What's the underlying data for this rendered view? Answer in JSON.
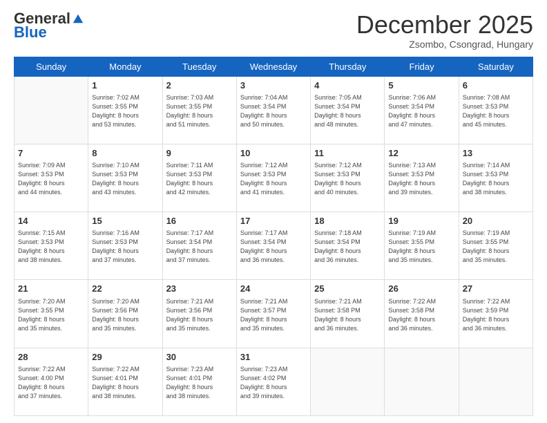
{
  "logo": {
    "general": "General",
    "blue": "Blue"
  },
  "header": {
    "month": "December 2025",
    "location": "Zsombo, Csongrad, Hungary"
  },
  "weekdays": [
    "Sunday",
    "Monday",
    "Tuesday",
    "Wednesday",
    "Thursday",
    "Friday",
    "Saturday"
  ],
  "weeks": [
    [
      {
        "day": null
      },
      {
        "day": 1,
        "sunrise": "7:02 AM",
        "sunset": "3:55 PM",
        "daylight": "8 hours and 53 minutes."
      },
      {
        "day": 2,
        "sunrise": "7:03 AM",
        "sunset": "3:55 PM",
        "daylight": "8 hours and 51 minutes."
      },
      {
        "day": 3,
        "sunrise": "7:04 AM",
        "sunset": "3:54 PM",
        "daylight": "8 hours and 50 minutes."
      },
      {
        "day": 4,
        "sunrise": "7:05 AM",
        "sunset": "3:54 PM",
        "daylight": "8 hours and 48 minutes."
      },
      {
        "day": 5,
        "sunrise": "7:06 AM",
        "sunset": "3:54 PM",
        "daylight": "8 hours and 47 minutes."
      },
      {
        "day": 6,
        "sunrise": "7:08 AM",
        "sunset": "3:53 PM",
        "daylight": "8 hours and 45 minutes."
      }
    ],
    [
      {
        "day": 7,
        "sunrise": "7:09 AM",
        "sunset": "3:53 PM",
        "daylight": "8 hours and 44 minutes."
      },
      {
        "day": 8,
        "sunrise": "7:10 AM",
        "sunset": "3:53 PM",
        "daylight": "8 hours and 43 minutes."
      },
      {
        "day": 9,
        "sunrise": "7:11 AM",
        "sunset": "3:53 PM",
        "daylight": "8 hours and 42 minutes."
      },
      {
        "day": 10,
        "sunrise": "7:12 AM",
        "sunset": "3:53 PM",
        "daylight": "8 hours and 41 minutes."
      },
      {
        "day": 11,
        "sunrise": "7:12 AM",
        "sunset": "3:53 PM",
        "daylight": "8 hours and 40 minutes."
      },
      {
        "day": 12,
        "sunrise": "7:13 AM",
        "sunset": "3:53 PM",
        "daylight": "8 hours and 39 minutes."
      },
      {
        "day": 13,
        "sunrise": "7:14 AM",
        "sunset": "3:53 PM",
        "daylight": "8 hours and 38 minutes."
      }
    ],
    [
      {
        "day": 14,
        "sunrise": "7:15 AM",
        "sunset": "3:53 PM",
        "daylight": "8 hours and 38 minutes."
      },
      {
        "day": 15,
        "sunrise": "7:16 AM",
        "sunset": "3:53 PM",
        "daylight": "8 hours and 37 minutes."
      },
      {
        "day": 16,
        "sunrise": "7:17 AM",
        "sunset": "3:54 PM",
        "daylight": "8 hours and 37 minutes."
      },
      {
        "day": 17,
        "sunrise": "7:17 AM",
        "sunset": "3:54 PM",
        "daylight": "8 hours and 36 minutes."
      },
      {
        "day": 18,
        "sunrise": "7:18 AM",
        "sunset": "3:54 PM",
        "daylight": "8 hours and 36 minutes."
      },
      {
        "day": 19,
        "sunrise": "7:19 AM",
        "sunset": "3:55 PM",
        "daylight": "8 hours and 35 minutes."
      },
      {
        "day": 20,
        "sunrise": "7:19 AM",
        "sunset": "3:55 PM",
        "daylight": "8 hours and 35 minutes."
      }
    ],
    [
      {
        "day": 21,
        "sunrise": "7:20 AM",
        "sunset": "3:55 PM",
        "daylight": "8 hours and 35 minutes."
      },
      {
        "day": 22,
        "sunrise": "7:20 AM",
        "sunset": "3:56 PM",
        "daylight": "8 hours and 35 minutes."
      },
      {
        "day": 23,
        "sunrise": "7:21 AM",
        "sunset": "3:56 PM",
        "daylight": "8 hours and 35 minutes."
      },
      {
        "day": 24,
        "sunrise": "7:21 AM",
        "sunset": "3:57 PM",
        "daylight": "8 hours and 35 minutes."
      },
      {
        "day": 25,
        "sunrise": "7:21 AM",
        "sunset": "3:58 PM",
        "daylight": "8 hours and 36 minutes."
      },
      {
        "day": 26,
        "sunrise": "7:22 AM",
        "sunset": "3:58 PM",
        "daylight": "8 hours and 36 minutes."
      },
      {
        "day": 27,
        "sunrise": "7:22 AM",
        "sunset": "3:59 PM",
        "daylight": "8 hours and 36 minutes."
      }
    ],
    [
      {
        "day": 28,
        "sunrise": "7:22 AM",
        "sunset": "4:00 PM",
        "daylight": "8 hours and 37 minutes."
      },
      {
        "day": 29,
        "sunrise": "7:22 AM",
        "sunset": "4:01 PM",
        "daylight": "8 hours and 38 minutes."
      },
      {
        "day": 30,
        "sunrise": "7:23 AM",
        "sunset": "4:01 PM",
        "daylight": "8 hours and 38 minutes."
      },
      {
        "day": 31,
        "sunrise": "7:23 AM",
        "sunset": "4:02 PM",
        "daylight": "8 hours and 39 minutes."
      },
      {
        "day": null
      },
      {
        "day": null
      },
      {
        "day": null
      }
    ]
  ],
  "labels": {
    "sunrise": "Sunrise:",
    "sunset": "Sunset:",
    "daylight": "Daylight:"
  }
}
